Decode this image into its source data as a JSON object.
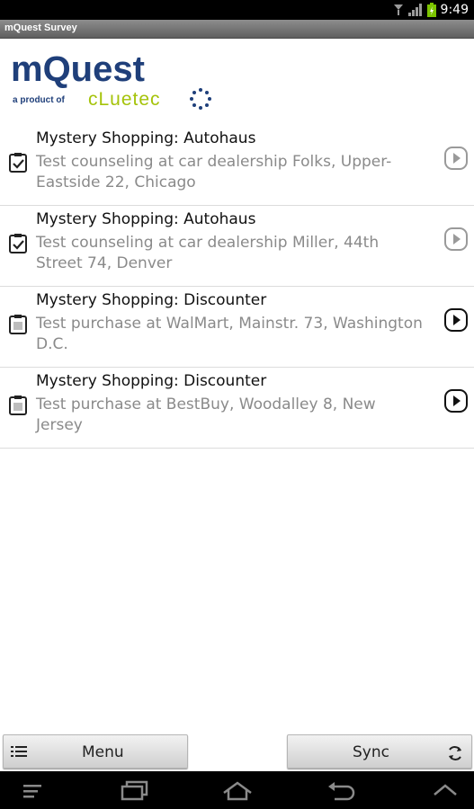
{
  "status_bar": {
    "time": "9:49",
    "icons": [
      "download-icon",
      "signal-icon",
      "battery-charging-icon"
    ]
  },
  "title_bar": {
    "title": "mQuest Survey"
  },
  "logo": {
    "name": "mQuest",
    "tagline": "a product of",
    "brand": "cLuetec",
    "colors": {
      "primary": "#1f3f7a",
      "brand": "#a5c30a"
    }
  },
  "surveys": [
    {
      "title": "Mystery Shopping: Autohaus",
      "description": "Test counseling at car dealership Folks, Upper-Eastside 22, Chicago",
      "status": "completed",
      "icon": "checked-clipboard-icon"
    },
    {
      "title": "Mystery Shopping: Autohaus",
      "description": "Test counseling at car dealership Miller, 44th Street 74, Denver",
      "status": "completed",
      "icon": "checked-clipboard-icon"
    },
    {
      "title": "Mystery Shopping: Discounter",
      "description": "Test purchase at WalMart, Mainstr. 73, Washington D.C.",
      "status": "open",
      "icon": "clipboard-icon"
    },
    {
      "title": "Mystery Shopping: Discounter",
      "description": "Test purchase at BestBuy, Woodalley 8, New Jersey",
      "status": "open",
      "icon": "clipboard-icon"
    }
  ],
  "bottom_bar": {
    "menu_label": "Menu",
    "sync_label": "Sync"
  },
  "nav_bar": {
    "buttons": [
      "menu-icon",
      "recent-apps-icon",
      "home-icon",
      "back-icon",
      "up-icon"
    ]
  }
}
